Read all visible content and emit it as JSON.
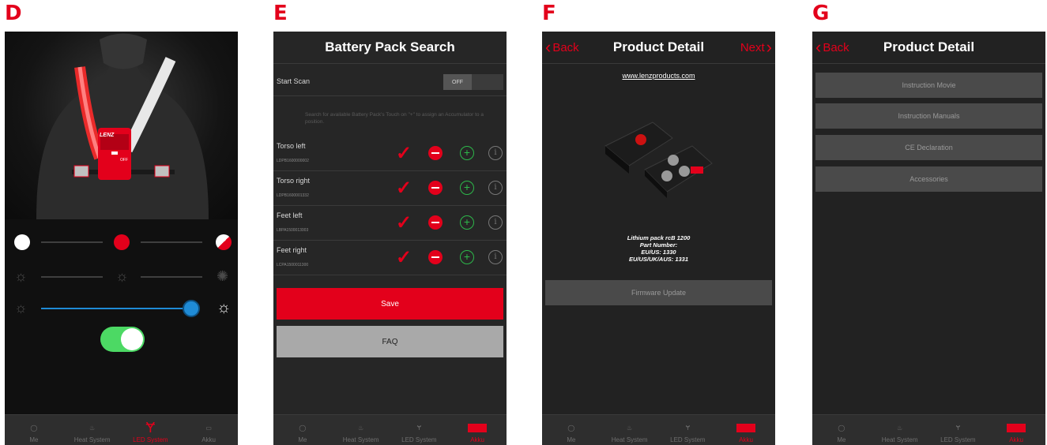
{
  "panels": {
    "d": {
      "letter": "D"
    },
    "e": {
      "letter": "E"
    },
    "f": {
      "letter": "F"
    },
    "g": {
      "letter": "G"
    }
  },
  "tabs_default": [
    {
      "label": "Me",
      "icon": "person-icon"
    },
    {
      "label": "Heat System",
      "icon": "heat-icon"
    },
    {
      "label": "LED System",
      "icon": "led-vest-icon"
    },
    {
      "label": "Akku",
      "icon": "battery-icon"
    }
  ],
  "panel_d": {
    "led_toggle_on": true,
    "brightness_level": 0.95,
    "logo": "LENZ",
    "logo_badge": "OFF"
  },
  "panel_e": {
    "title": "Battery Pack Search",
    "start_scan_label": "Start Scan",
    "scan_toggle": "OFF",
    "hint": "Search for available Battery Pack's Touch on \"+\" to assign an Accumulator to a position.",
    "positions": [
      {
        "name": "Torso left",
        "code": "LDPB1600000002"
      },
      {
        "name": "Torso right",
        "code": "LDPB1600001332"
      },
      {
        "name": "Feet left",
        "code": "LBPA1500013003"
      },
      {
        "name": "Feet right",
        "code": "LCPA1500011300"
      }
    ],
    "save_label": "Save",
    "faq_label": "FAQ"
  },
  "panel_f": {
    "back": "Back",
    "title": "Product Detail",
    "next": "Next",
    "url": "www.lenzproducts.com",
    "product_name": "Lithium pack rcB 1200",
    "part_number_label": "Part Number:",
    "eu_us": "EU/US: 1330",
    "eu_us_uk_aus": "EU/US/UK/AUS: 1331",
    "firmware_label": "Firmware Update"
  },
  "panel_g": {
    "back": "Back",
    "title": "Product Detail",
    "items": [
      "Instruction Movie",
      "Instruction Manuals",
      "CE Declaration",
      "Accessories"
    ]
  },
  "colors": {
    "accent": "#e3001b",
    "toggle_green": "#4cd964",
    "slider_blue": "#1f8bd6"
  }
}
